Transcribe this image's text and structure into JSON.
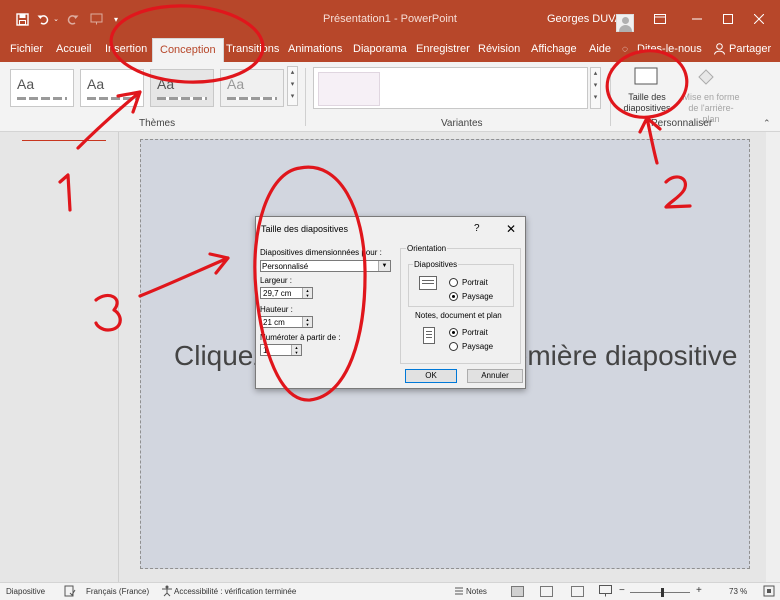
{
  "titlebar": {
    "title": "Présentation1  -  PowerPoint",
    "user": "Georges DUVAL",
    "save_icon": "save-icon",
    "undo_icon": "undo-icon",
    "redo_icon": "redo-icon"
  },
  "tabs": [
    {
      "label": "Fichier",
      "active": false
    },
    {
      "label": "Accueil",
      "active": false
    },
    {
      "label": "Insertion",
      "active": false
    },
    {
      "label": "Conception",
      "active": true
    },
    {
      "label": "Transitions",
      "active": false
    },
    {
      "label": "Animations",
      "active": false
    },
    {
      "label": "Diaporama",
      "active": false
    },
    {
      "label": "Enregistrer",
      "active": false
    },
    {
      "label": "Révision",
      "active": false
    },
    {
      "label": "Affichage",
      "active": false
    },
    {
      "label": "Aide",
      "active": false
    },
    {
      "label": "Dites-le-nous",
      "active": false
    }
  ],
  "share_label": "Partager",
  "ribbon": {
    "themes_label": "Thèmes",
    "variants_label": "Variantes",
    "customize_label": "Personnaliser",
    "theme_thumb_text": "Aa",
    "slide_size_label_1": "Taille des",
    "slide_size_label_2": "diapositives",
    "format_bg_label_1": "Mise en forme",
    "format_bg_label_2": "de l'arrière-plan"
  },
  "slide": {
    "placeholder": "Cliquez pour ajouter une première diapositive"
  },
  "dialog": {
    "title": "Taille des diapositives",
    "help": "?",
    "sized_for_label": "Diapositives dimensionnées pour :",
    "sized_for_value": "Personnalisé",
    "width_label": "Largeur :",
    "width_value": "29,7 cm",
    "height_label": "Hauteur :",
    "height_value": "21 cm",
    "number_from_label": "Numéroter à partir de :",
    "number_from_value": "1",
    "orientation_label": "Orientation",
    "slides_label": "Diapositives",
    "slides_portrait": "Portrait",
    "slides_landscape": "Paysage",
    "notes_label": "Notes, document et plan",
    "notes_portrait": "Portrait",
    "notes_landscape": "Paysage",
    "ok": "OK",
    "cancel": "Annuler"
  },
  "statusbar": {
    "slide_label": "Diapositive",
    "language": "Français (France)",
    "accessibility": "Accessibilité : vérification terminée",
    "notes": "Notes",
    "zoom": "73 %"
  },
  "annotations": {
    "n1": "1",
    "n2": "2",
    "n3": "3",
    "color": "#e0161c"
  }
}
